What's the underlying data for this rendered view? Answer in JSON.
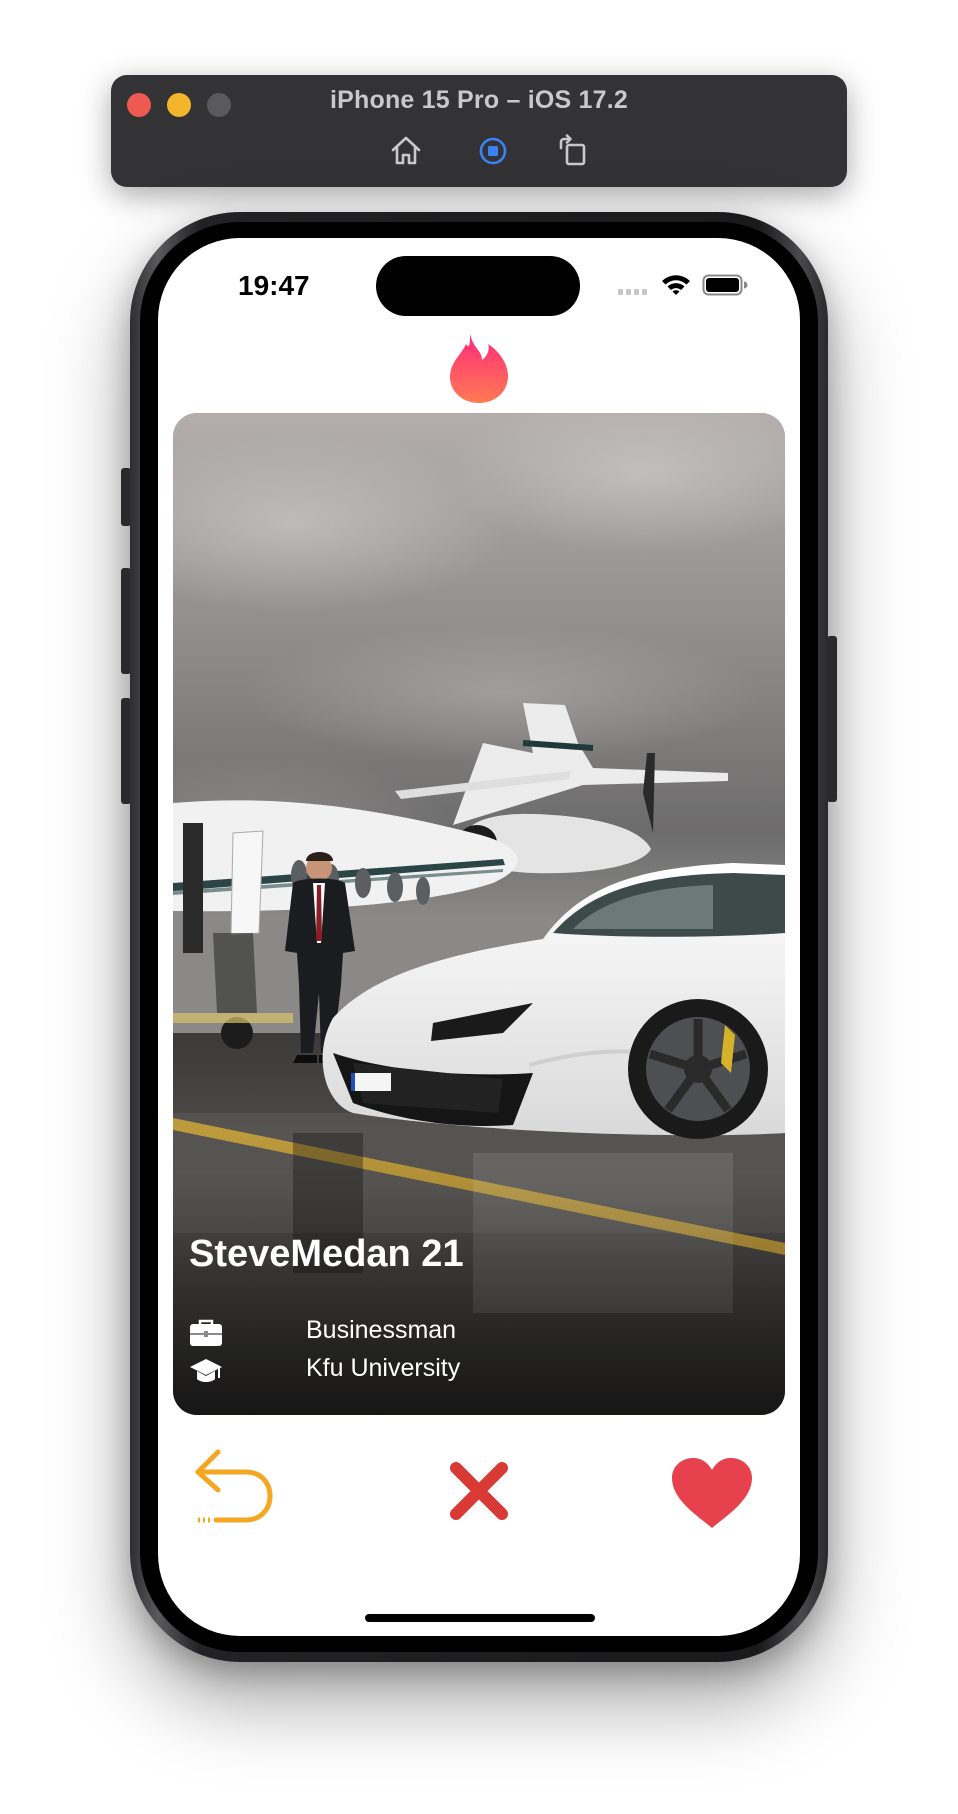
{
  "simulator": {
    "title": "iPhone 15 Pro – iOS 17.2",
    "buttons": {
      "home": "home-icon",
      "screenshot": "screenshot-icon",
      "rotate": "rotate-icon"
    },
    "traffic_light_colors": [
      "#ee5a52",
      "#f2b52c",
      "#5a5a5d"
    ]
  },
  "status_bar": {
    "time": "19:47",
    "icons": [
      "signal-icon",
      "wifi-icon",
      "battery-icon"
    ]
  },
  "app": {
    "logo": "flame-icon",
    "brand_gradient": [
      "#fd297b",
      "#ff5864",
      "#ff655b"
    ]
  },
  "card": {
    "name_age": "SteveMedan 21",
    "job": "Businessman",
    "school": "Kfu University",
    "job_icon": "briefcase-icon",
    "school_icon": "graduation-cap-icon",
    "photo": "man-with-jet-and-sports-car-photo"
  },
  "actions": {
    "undo": {
      "icon": "undo-icon",
      "color": "#f5a623"
    },
    "nope": {
      "icon": "close-icon",
      "color": "#d93a36"
    },
    "like": {
      "icon": "heart-icon",
      "color": "#e8414e"
    }
  }
}
